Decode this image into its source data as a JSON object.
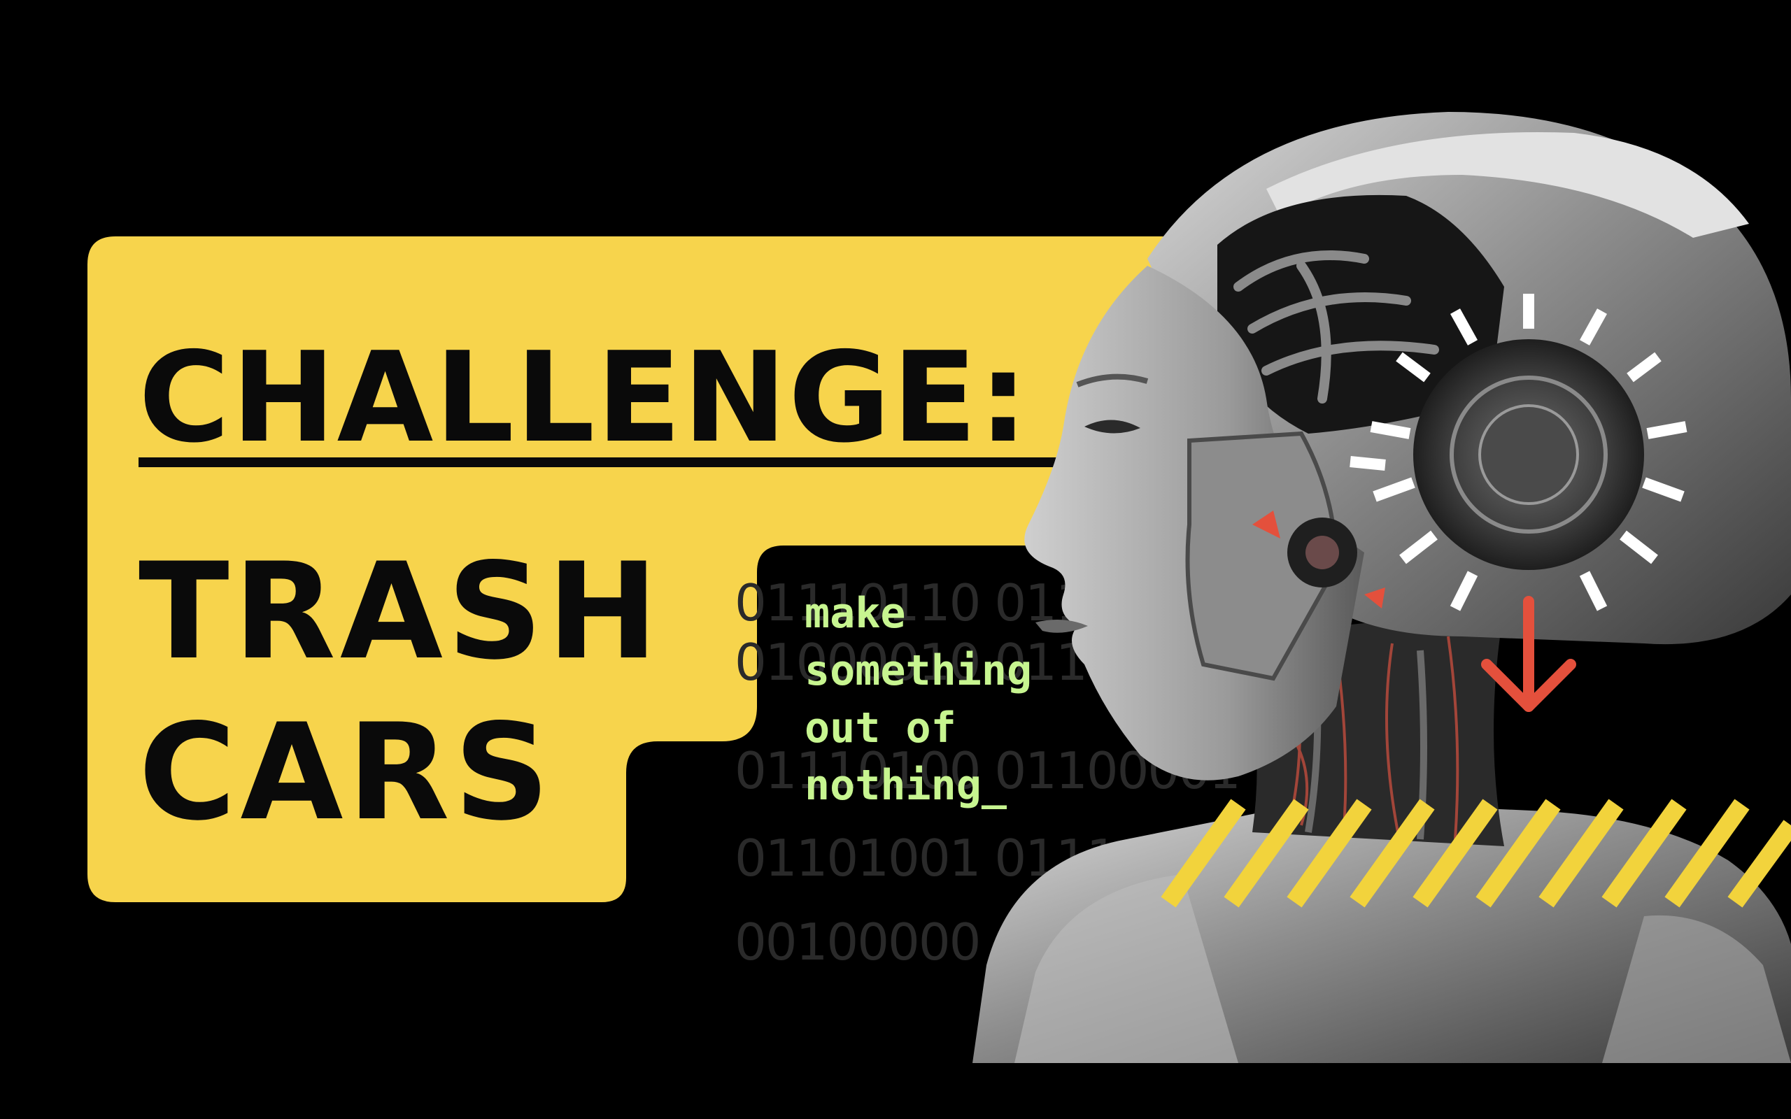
{
  "colors": {
    "background": "#000000",
    "panel": "#f7d44c",
    "title_text": "#0a0a0a",
    "terminal_text": "#c7f590",
    "binary_text": "#2a2a2a",
    "accent_red": "#e4503c",
    "stripe_yellow": "#f2d33c",
    "tick_white": "#ffffff"
  },
  "headline": {
    "line1": "CHALLENGE:",
    "line2": "TRASH",
    "line3": "CARS"
  },
  "binary_rows": [
    "01110110  01100",
    "01000010  01110",
    "01110100  01100001  0110",
    "01101001  01110011  0110",
    "00100000"
  ],
  "tagline": {
    "line1": "make",
    "line2": "something",
    "line3": "out of",
    "line4": "nothing_"
  },
  "illustration": {
    "subject": "robot-head-icon"
  }
}
